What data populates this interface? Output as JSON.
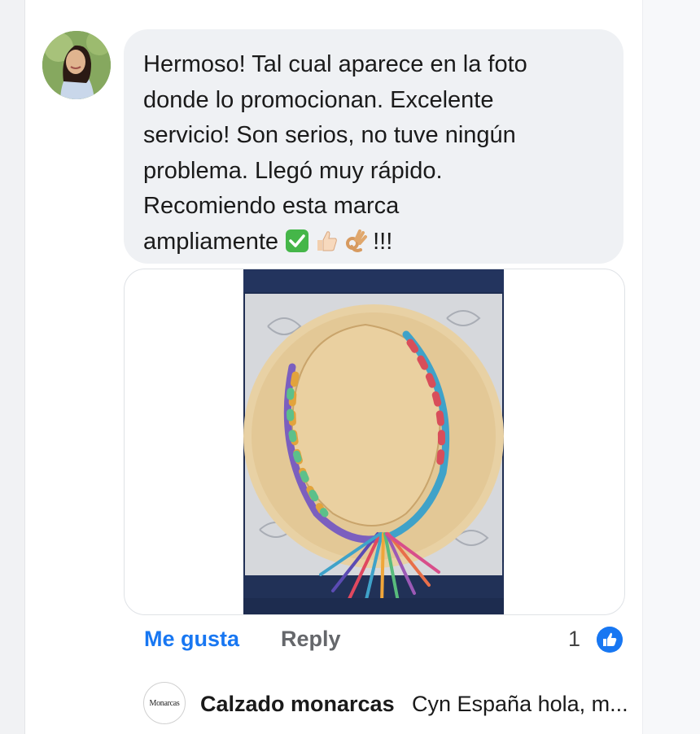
{
  "comment": {
    "lines": [
      "Hermoso! Tal cual aparece en la foto",
      "donde lo promocionan. Excelente",
      "servicio! Son serios, no tuve ningún",
      "problema. Llegó muy rápido.",
      "Recomiendo esta marca"
    ],
    "last_line_text": "ampliamente",
    "trailing": "!!!",
    "emojis": [
      "check-mark-icon",
      "thumbs-up-icon",
      "ok-hand-icon"
    ]
  },
  "actions": {
    "like_label": "Me gusta",
    "reply_label": "Reply",
    "reaction_count": "1"
  },
  "reply": {
    "author": "Calzado monarcas",
    "snippet": "Cyn España hola, m...",
    "avatar_text": "Monarcas"
  },
  "colors": {
    "link_blue": "#1877f2",
    "bubble_bg": "#eff1f4",
    "muted_text": "#65676b"
  }
}
